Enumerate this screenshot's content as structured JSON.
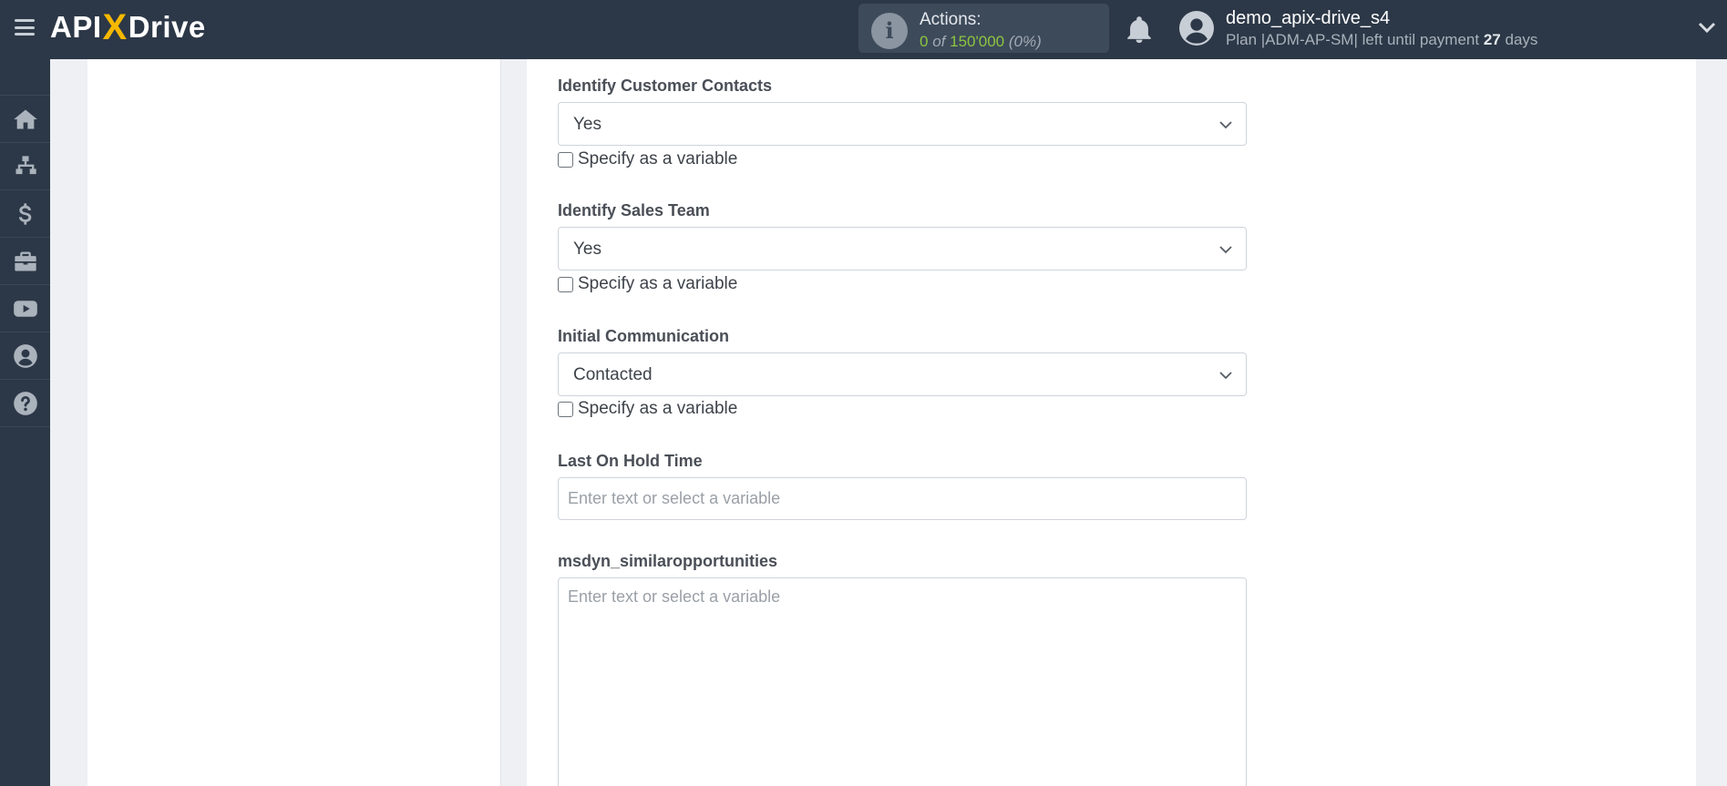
{
  "header": {
    "logo": {
      "api": "API",
      "x": "X",
      "drive": "Drive"
    },
    "actions": {
      "label": "Actions:",
      "used": "0",
      "of": "of",
      "limit": "150'000",
      "percent": "(0%)"
    },
    "user": {
      "name": "demo_apix-drive_s4",
      "plan_prefix": "Plan |ADM-AP-SM| left until payment",
      "days_count": "27",
      "days_suffix": "days"
    }
  },
  "sidebar": {
    "items": [
      {
        "icon": "home-icon"
      },
      {
        "icon": "sitemap-icon"
      },
      {
        "icon": "dollar-icon"
      },
      {
        "icon": "briefcase-icon"
      },
      {
        "icon": "youtube-icon"
      },
      {
        "icon": "user-circle-icon"
      },
      {
        "icon": "help-icon"
      }
    ]
  },
  "form": {
    "checkbox_label": "Specify as a variable",
    "fields": [
      {
        "label": "Identify Customer Contacts",
        "value": "Yes"
      },
      {
        "label": "Identify Sales Team",
        "value": "Yes"
      },
      {
        "label": "Initial Communication",
        "value": "Contacted"
      },
      {
        "label": "Last On Hold Time",
        "placeholder": "Enter text or select a variable"
      },
      {
        "label": "msdyn_similaropportunities",
        "placeholder": "Enter text or select a variable"
      }
    ]
  },
  "colors": {
    "header_bg": "#2c3847",
    "logo_accent": "#f5b800",
    "actions_used": "#8cc63f"
  }
}
